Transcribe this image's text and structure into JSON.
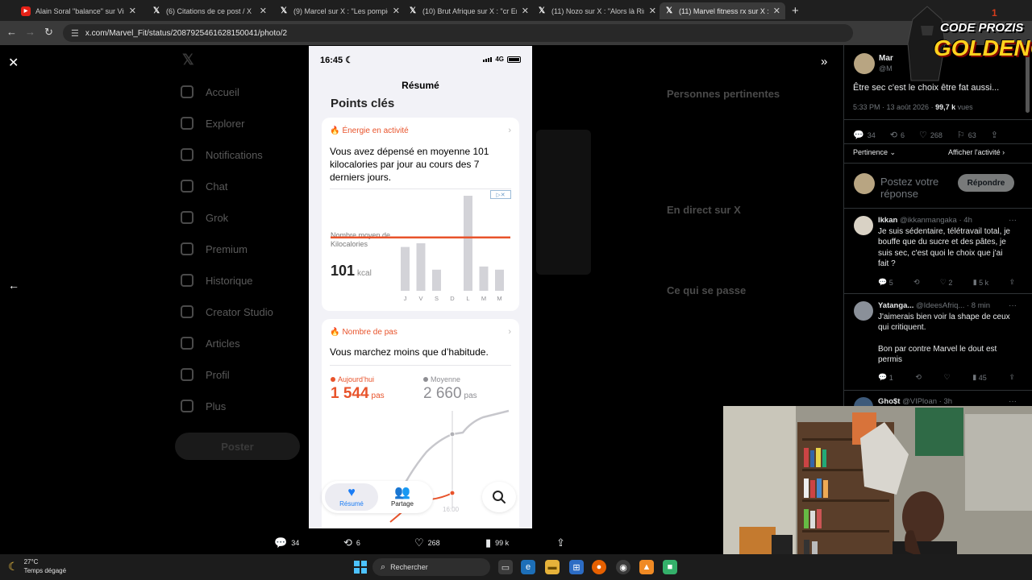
{
  "browser": {
    "tabs": [
      {
        "label": "Alain Soral \"balance\" sur Vincent",
        "icon": "youtube-icon"
      },
      {
        "label": "(6) Citations de ce post / X",
        "icon": "x-logo-icon"
      },
      {
        "label": "(9) Marcel sur X : \"Les pompiers",
        "icon": "x-logo-icon"
      },
      {
        "label": "(10) Brut Afrique sur X : \"cr En n",
        "icon": "x-logo-icon"
      },
      {
        "label": "(11) Nozo sur X : \"Alors là Rima",
        "icon": "x-logo-icon"
      },
      {
        "label": "(11) Marvel fitness rx sur X : \"Êt",
        "icon": "x-logo-icon"
      }
    ],
    "url": "x.com/Marvel_Fit/status/2087925461628150041/photo/2"
  },
  "background_nav": [
    "Accueil",
    "Explorer",
    "Notifications",
    "Chat",
    "Grok",
    "Premium",
    "Historique",
    "Creator Studio",
    "Articles",
    "Profil",
    "Plus"
  ],
  "background_post_button": "Poster",
  "background_headings": {
    "related": "Personnes pertinentes",
    "live": "En direct sur X",
    "happening": "Ce qui se passe"
  },
  "phone": {
    "time": "16:45",
    "network": "4G",
    "title": "Résumé",
    "section": "Points clés",
    "energy_card": {
      "heading": "Énergie en activité",
      "text": "Vous avez dépensé en moyenne 101 kilocalories par jour au cours des 7 derniers jours.",
      "avg_label": "Nombre moyen de Kilocalories",
      "avg_value": "101",
      "avg_unit": "kcal"
    },
    "steps_card": {
      "heading": "Nombre de pas",
      "text": "Vous marchez moins que d’habitude.",
      "today_label": "Aujourd’hui",
      "today_value": "1 544",
      "avg_label": "Moyenne",
      "avg_value": "2 660",
      "unit": "pas",
      "time_label": "16:00"
    },
    "bottom_tabs": [
      {
        "label": "Résumé",
        "icon": "heart-icon"
      },
      {
        "label": "Partage",
        "icon": "people-icon"
      }
    ]
  },
  "chart_data": [
    {
      "type": "bar",
      "categories": [
        "J",
        "V",
        "S",
        "D",
        "L",
        "M",
        "M"
      ],
      "values": [
        83,
        90,
        40,
        0,
        180,
        46,
        40
      ],
      "average": 101,
      "ylabel": "Nombre moyen de Kilocalories",
      "colors": {
        "bars": "#d3d3d8",
        "average_line": "#e8532b"
      }
    },
    {
      "type": "line",
      "series": [
        {
          "name": "Aujourd’hui",
          "color": "#e8532b"
        },
        {
          "name": "Moyenne",
          "color": "#c7c7cc"
        }
      ]
    }
  ],
  "viewer_metrics": {
    "replies": "34",
    "reposts": "6",
    "likes": "268",
    "views": "99 k"
  },
  "tweet": {
    "author": "Mar",
    "handle": "@M",
    "text": "Être sec c'est le choix être fat aussi...",
    "time": "5:33 PM · 13 août 2026 · ",
    "views": "99,7 k",
    "views_suffix": " vues",
    "actions": {
      "replies": "34",
      "reposts": "6",
      "likes": "268",
      "bookmarks": "63"
    },
    "sort_label": "Pertinence",
    "activity_label": "Afficher l'activité",
    "compose_placeholder": "Postez votre réponse",
    "reply_button": "Répondre"
  },
  "replies": [
    {
      "name": "Ikkan",
      "handle": "@ikkanmangaka",
      "time": "· 4h",
      "text": "Je suis sédentaire, télétravail total, je bouffe que du sucre et des pâtes, je suis sec, c'est quoi le choix que j'ai fait ?",
      "replies": "5",
      "likes": "2",
      "views": "5 k"
    },
    {
      "name": "Yatanga...",
      "handle": "@IdeesAfriq...",
      "time": "· 8 min",
      "text": "J'aimerais bien voir la shape de ceux qui critiquent.\n\nBon par contre Marvel le dout est permis",
      "replies": "1",
      "likes": "",
      "views": "45"
    },
    {
      "name": "Gho$t",
      "handle": "@VIPloan",
      "time": "· 3h",
      "text": "",
      "replies": "",
      "likes": "",
      "views": ""
    }
  ],
  "stream_logo": {
    "line0": "1",
    "line1": "CODE PROZIS",
    "line2": "GOLDENG"
  },
  "taskbar": {
    "temperature": "27°C",
    "weather": "Temps dégagé",
    "search": "Rechercher"
  }
}
